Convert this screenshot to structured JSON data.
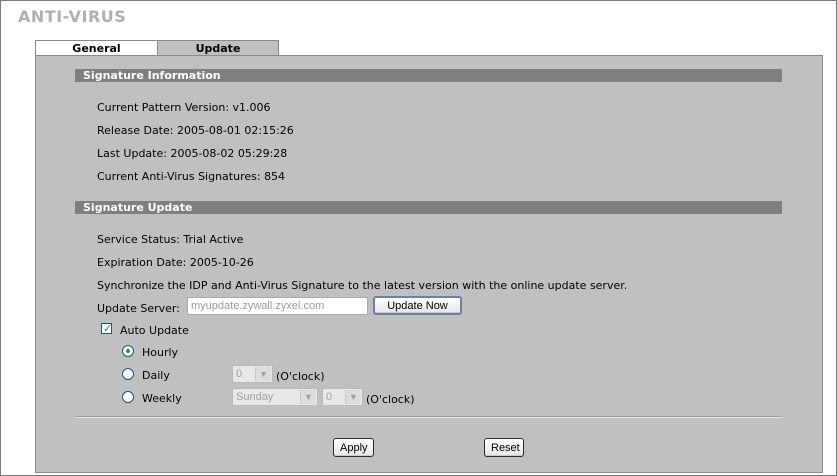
{
  "page_title": "ANTI-VIRUS",
  "tabs": [
    {
      "label": "General"
    },
    {
      "label": "Update"
    }
  ],
  "signature_info": {
    "header": "Signature Information",
    "current_pattern_version": "Current Pattern Version: v1.006",
    "release_date": "Release Date: 2005-08-01 02:15:26",
    "last_update": "Last Update: 2005-08-02 05:29:28",
    "current_signatures": "Current Anti-Virus Signatures: 854"
  },
  "signature_update": {
    "header": "Signature Update",
    "service_status": "Service Status: Trial Active",
    "expiration_date": "Expiration Date: 2005-10-26",
    "sync_text": "Synchronize the IDP and Anti-Virus Signature to the latest version with the online update server.",
    "update_server_label": "Update Server:",
    "update_server_value": "myupdate.zywall.zyxel.com",
    "update_now_label": "Update Now",
    "auto_update_label": "Auto Update",
    "auto_update_checked": true,
    "hourly_label": "Hourly",
    "daily_label": "Daily",
    "weekly_label": "Weekly",
    "selected_frequency": "Hourly",
    "daily_hour": "0",
    "weekly_day": "Sunday",
    "weekly_hour": "0",
    "oclock_label": "(O'clock)"
  },
  "buttons": {
    "apply": "Apply",
    "reset": "Reset"
  },
  "colors": {
    "panel_bg": "#c0c0c0",
    "section_bar": "#7f7f7f",
    "title_gray": "#b0b0b0",
    "check_green": "#21a121"
  }
}
